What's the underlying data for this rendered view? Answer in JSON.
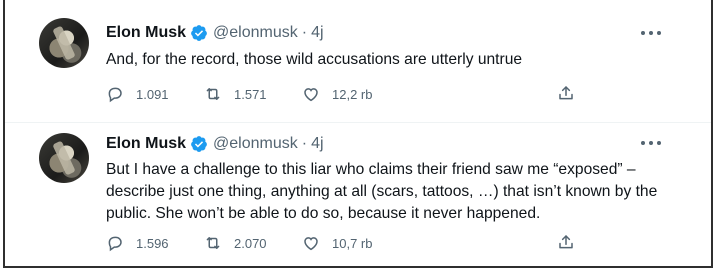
{
  "tweets": [
    {
      "name": "Elon Musk",
      "handle": "@elonmusk",
      "dot": "·",
      "time": "4j",
      "text": "And, for the record, those wild accusations are utterly untrue",
      "replies": "1.091",
      "retweets": "1.571",
      "likes": "12,2 rb"
    },
    {
      "name": "Elon Musk",
      "handle": "@elonmusk",
      "dot": "·",
      "time": "4j",
      "text": "But I have a challenge to this liar who claims their friend saw me “exposed” – describe just one thing, anything at all (scars, tattoos, …) that isn’t known by the public. She won’t be able to do so, because it never happened.",
      "replies": "1.596",
      "retweets": "2.070",
      "likes": "10,7 rb"
    }
  ],
  "colors": {
    "text": "#0f1419",
    "muted": "#536471",
    "verified": "#1d9bf0"
  },
  "icons": [
    "verified-badge-icon",
    "more-icon",
    "reply-icon",
    "retweet-icon",
    "like-icon",
    "share-icon"
  ]
}
